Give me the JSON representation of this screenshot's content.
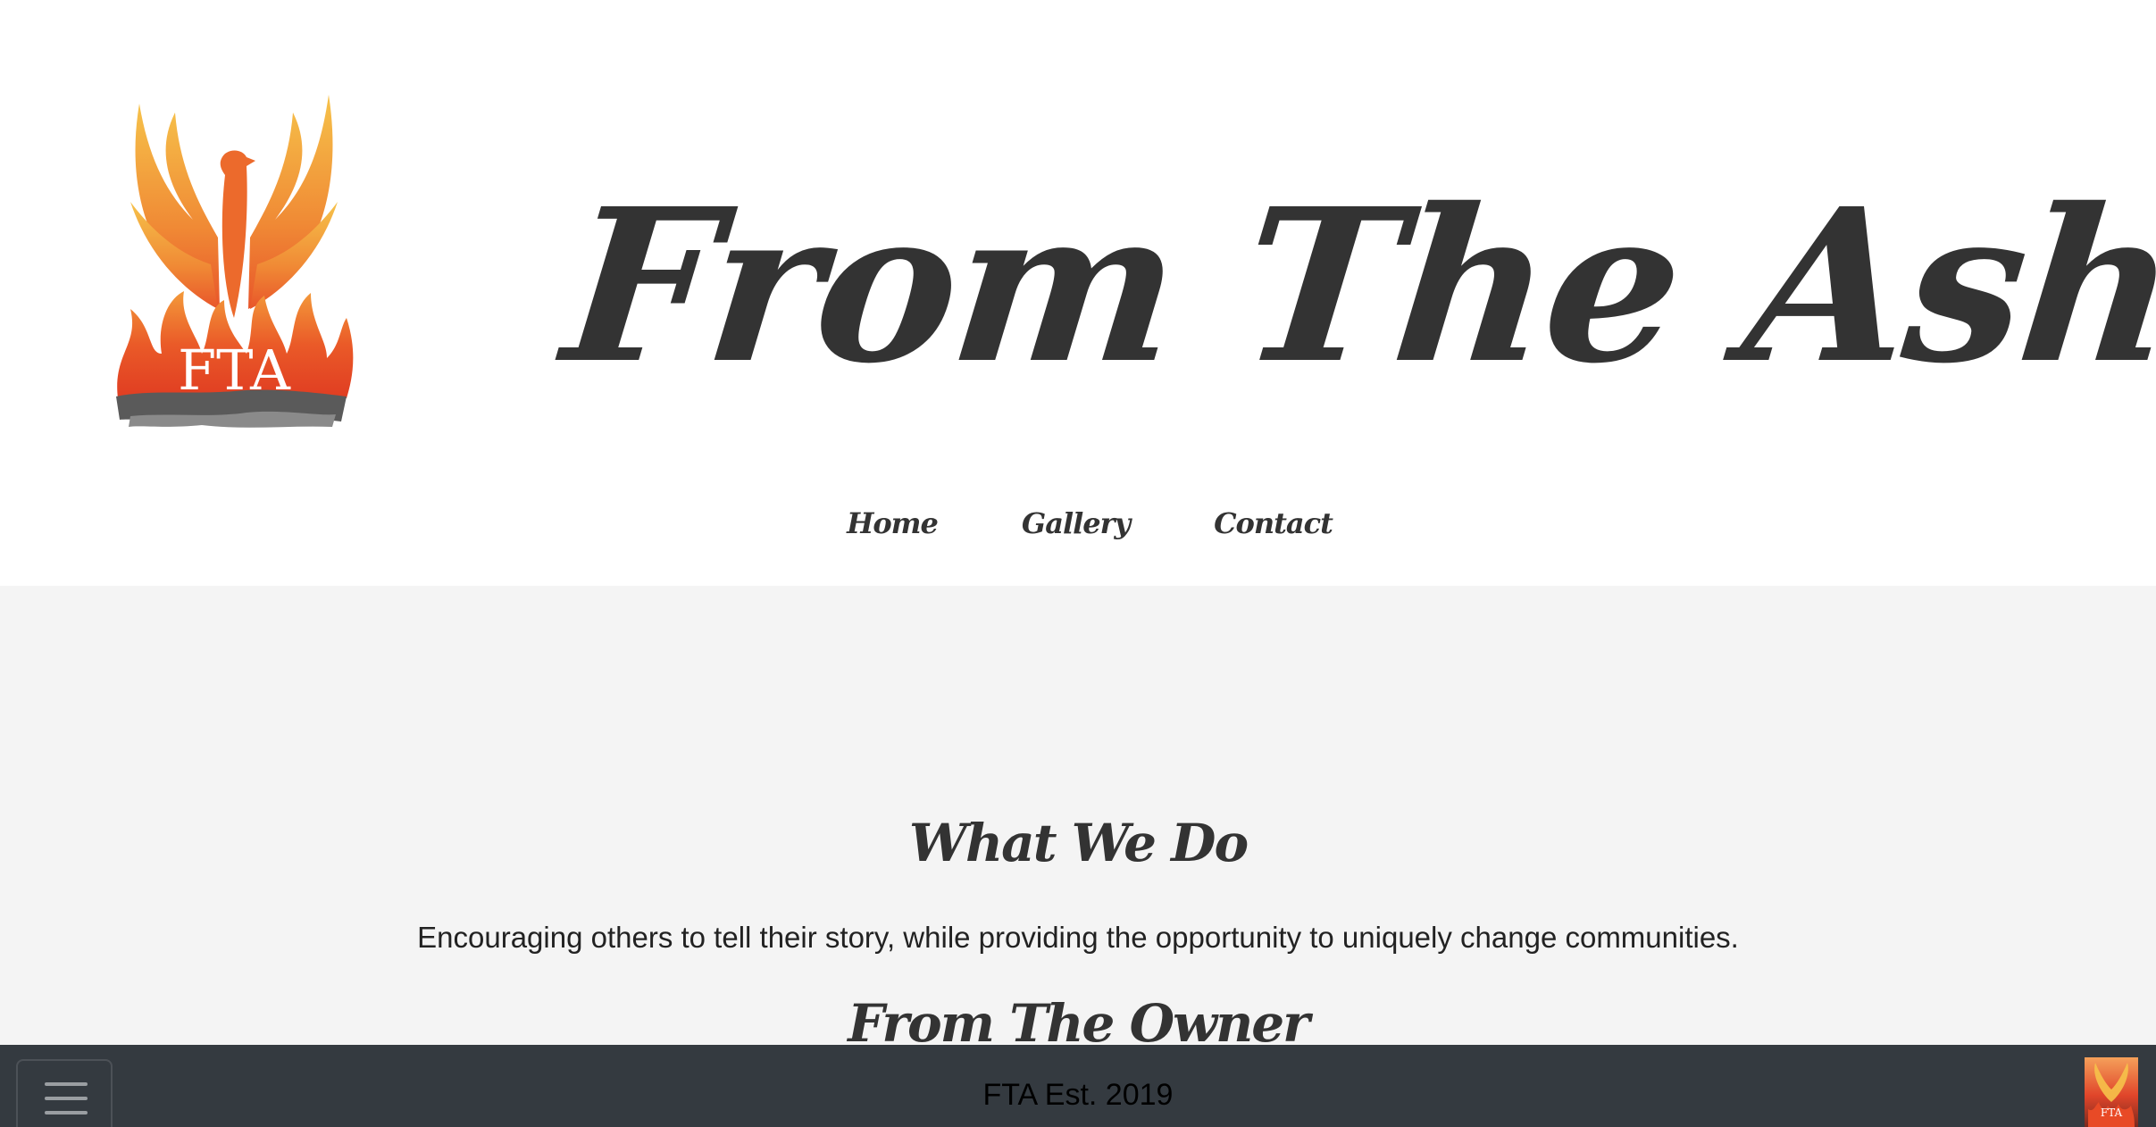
{
  "header": {
    "logo_text": "FTA",
    "title": "From The Ashes"
  },
  "nav": {
    "items": [
      {
        "label": "Home"
      },
      {
        "label": "Gallery"
      },
      {
        "label": "Contact"
      }
    ]
  },
  "main": {
    "what_heading": "What We Do",
    "what_text": "Encouraging others to tell their story, while providing the opportunity to uniquely change communities.",
    "owner_heading": "From The Owner"
  },
  "footer": {
    "text": "FTA Est. 2019",
    "menu_icon": "hamburger-menu-icon",
    "thumb_text": "FTA"
  },
  "colors": {
    "header_bg": "#ffffff",
    "section_bg": "#f4f4f4",
    "footer_bg": "#343a40",
    "text_dark": "#333333",
    "logo_flame_orange": "#ef6a2c",
    "logo_flame_yellow": "#f6c24a"
  }
}
